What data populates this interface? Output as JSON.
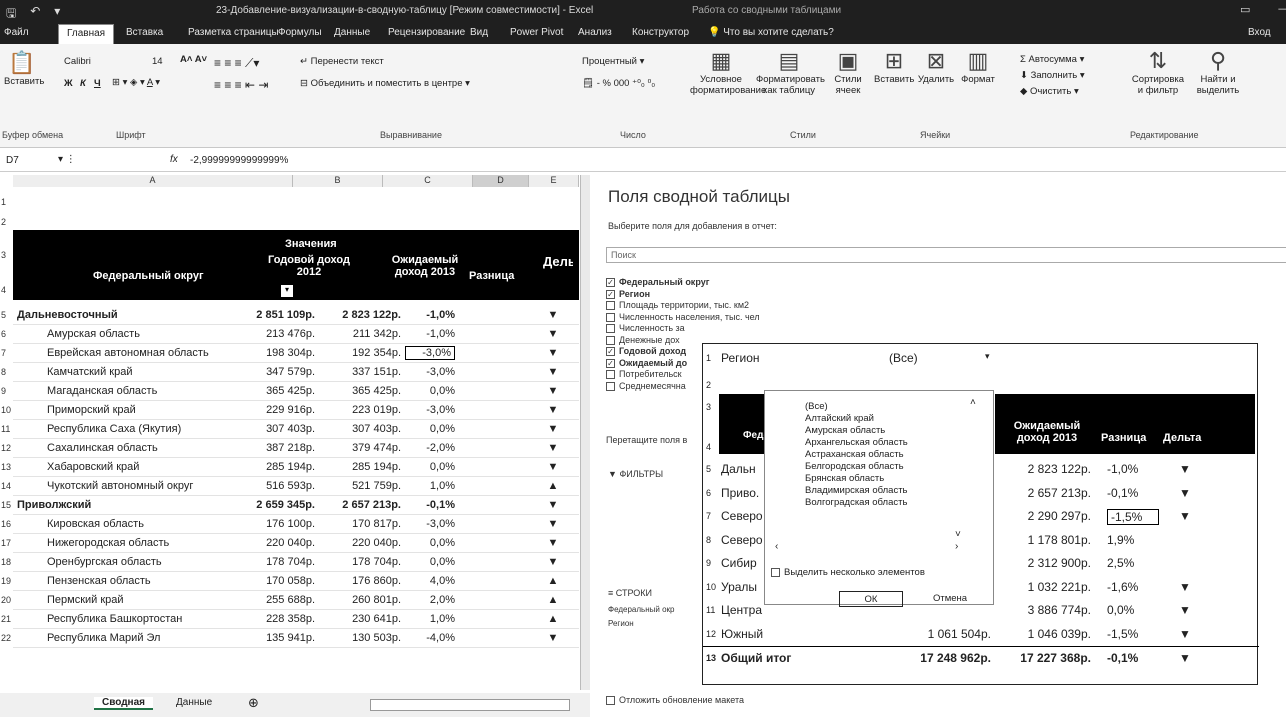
{
  "titlebar": {
    "save_icon": "save-icon",
    "undo_icon": "undo-icon",
    "title": "23-Добавление-визуализации-в-сводную-таблицу [Режим совместимости] - Excel",
    "context": "Работа со сводными таблицами",
    "restore": "▭",
    "minimize": "—"
  },
  "tabs": [
    "Файл",
    "Главная",
    "Вставка",
    "Разметка страницы",
    "Формулы",
    "Данные",
    "Рецензирование",
    "Вид",
    "Power Pivot",
    "Анализ",
    "Конструктор",
    "Что вы хотите сделать?",
    "Вход"
  ],
  "ribbon": {
    "paste": "Вставить",
    "font": "Calibri",
    "font_size": "14",
    "bold": "Ж",
    "italic": "К",
    "underline": "Ч",
    "wrap": "Перенести текст",
    "merge": "Объединить и поместить в центре",
    "number_format": "Процентный",
    "cond_format": "Условное форматирование",
    "format_table": "Форматировать как таблицу",
    "cell_styles": "Стили ячеек",
    "insert": "Вставить",
    "delete": "Удалить",
    "format": "Формат",
    "autosum": "Автосумма",
    "fill": "Заполнить",
    "clear": "Очистить",
    "sort": "Сортировка и фильтр",
    "find": "Найти и выделить",
    "groups": [
      "Буфер обмена",
      "Шрифт",
      "Выравнивание",
      "Число",
      "Стили",
      "Ячейки",
      "Редактирование"
    ]
  },
  "formula_bar": {
    "cell": "D7",
    "fx": "fx",
    "value": "-2,99999999999999%"
  },
  "columns": [
    "A",
    "B",
    "C",
    "D",
    "E"
  ],
  "header": {
    "values": "Значения",
    "district": "Федеральный округ",
    "income2012": "Годовой доход 2012",
    "income2013": "Ожидаемый доход 2013",
    "diff": "Разница",
    "delta": "Дельта"
  },
  "rows": [
    {
      "n": "5",
      "a": "Дальневосточный",
      "b": "2 851 109р.",
      "c": "2 823 122р.",
      "d": "-1,0%",
      "e": "▼",
      "bold": true
    },
    {
      "n": "6",
      "a": "Амурская область",
      "b": "213 476р.",
      "c": "211 342р.",
      "d": "-1,0%",
      "e": "▼"
    },
    {
      "n": "7",
      "a": "Еврейская автономная область",
      "b": "198 304р.",
      "c": "192 354р.",
      "d": "-3,0%",
      "e": "▼"
    },
    {
      "n": "8",
      "a": "Камчатский край",
      "b": "347 579р.",
      "c": "337 151р.",
      "d": "-3,0%",
      "e": "▼"
    },
    {
      "n": "9",
      "a": "Магаданская область",
      "b": "365 425р.",
      "c": "365 425р.",
      "d": "0,0%",
      "e": "▼"
    },
    {
      "n": "10",
      "a": "Приморский край",
      "b": "229 916р.",
      "c": "223 019р.",
      "d": "-3,0%",
      "e": "▼"
    },
    {
      "n": "11",
      "a": "Республика Саха (Якутия)",
      "b": "307 403р.",
      "c": "307 403р.",
      "d": "0,0%",
      "e": "▼"
    },
    {
      "n": "12",
      "a": "Сахалинская область",
      "b": "387 218р.",
      "c": "379 474р.",
      "d": "-2,0%",
      "e": "▼"
    },
    {
      "n": "13",
      "a": "Хабаровский край",
      "b": "285 194р.",
      "c": "285 194р.",
      "d": "0,0%",
      "e": "▼"
    },
    {
      "n": "14",
      "a": "Чукотский автономный округ",
      "b": "516 593р.",
      "c": "521 759р.",
      "d": "1,0%",
      "e": "▲"
    },
    {
      "n": "15",
      "a": "Приволжский",
      "b": "2 659 345р.",
      "c": "2 657 213р.",
      "d": "-0,1%",
      "e": "▼",
      "bold": true
    },
    {
      "n": "16",
      "a": "Кировская область",
      "b": "176 100р.",
      "c": "170 817р.",
      "d": "-3,0%",
      "e": "▼"
    },
    {
      "n": "17",
      "a": "Нижегородская область",
      "b": "220 040р.",
      "c": "220 040р.",
      "d": "0,0%",
      "e": "▼"
    },
    {
      "n": "18",
      "a": "Оренбургская область",
      "b": "178 704р.",
      "c": "178 704р.",
      "d": "0,0%",
      "e": "▼"
    },
    {
      "n": "19",
      "a": "Пензенская область",
      "b": "170 058р.",
      "c": "176 860р.",
      "d": "4,0%",
      "e": "▲"
    },
    {
      "n": "20",
      "a": "Пермский край",
      "b": "255 688р.",
      "c": "260 801р.",
      "d": "2,0%",
      "e": "▲"
    },
    {
      "n": "21",
      "a": "Республика Башкортостан",
      "b": "228 358р.",
      "c": "230 641р.",
      "d": "1,0%",
      "e": "▲"
    },
    {
      "n": "22",
      "a": "Республика Марий Эл",
      "b": "135 941р.",
      "c": "130 503р.",
      "d": "-4,0%",
      "e": "▼"
    }
  ],
  "panel": {
    "title": "Поля сводной таблицы",
    "subtitle": "Выберите поля для добавления в отчет:",
    "search": "Поиск",
    "fields": [
      {
        "label": "Федеральный округ",
        "checked": true,
        "bold": true
      },
      {
        "label": "Регион",
        "checked": true,
        "bold": true
      },
      {
        "label": "Площадь территории, тыс. км2",
        "checked": false
      },
      {
        "label": "Численность населения, тыс. чел",
        "checked": false
      },
      {
        "label": "Численность за",
        "checked": false
      },
      {
        "label": "Денежные дох",
        "checked": false
      },
      {
        "label": "Годовой доход",
        "checked": true,
        "bold": true
      },
      {
        "label": "Ожидаемый до",
        "checked": true,
        "bold": true
      },
      {
        "label": "Потребительск",
        "checked": false
      },
      {
        "label": "Среднемесячна",
        "checked": false
      }
    ],
    "drag": "Перетащите поля в",
    "filters": "ФИЛЬТРЫ",
    "rows_area": "СТРОКИ",
    "row_items": [
      "Федеральный окр",
      "Регион"
    ],
    "defer": "Отложить обновление макета"
  },
  "pivot2": {
    "filter_label": "Регион",
    "filter_value": "(Все)",
    "header_income": "Ожидаемый доход 2013",
    "header_diff": "Разница",
    "header_delta": "Дельта",
    "header_district": "Феде",
    "rows": [
      {
        "n": "5",
        "a": "Дальн",
        "c": "2 823 122р.",
        "d": "-1,0%",
        "e": "▼"
      },
      {
        "n": "6",
        "a": "Приво.",
        "c": "2 657 213р.",
        "d": "-0,1%",
        "e": "▼"
      },
      {
        "n": "7",
        "a": "Северо",
        "c": "2 290 297р.",
        "d": "-1,5%",
        "e": "▼"
      },
      {
        "n": "8",
        "a": "Северо",
        "c": "1 178 801р.",
        "d": "1,9%",
        "e": ""
      },
      {
        "n": "9",
        "a": "Сибир",
        "c": "2 312 900р.",
        "d": "2,5%",
        "e": ""
      },
      {
        "n": "10",
        "a": "Уралы",
        "c": "1 032 221р.",
        "d": "-1,6%",
        "e": "▼"
      },
      {
        "n": "11",
        "a": "Центра",
        "c": "3 886 774р.",
        "d": "0,0%",
        "e": "▼"
      },
      {
        "n": "12",
        "a": "Южный",
        "b": "1 061 504р.",
        "c": "1 046 039р.",
        "d": "-1,5%",
        "e": "▼"
      }
    ],
    "total": {
      "n": "13",
      "a": "Общий итог",
      "b": "17 248 962р.",
      "c": "17 227 368р.",
      "d": "-0,1%",
      "e": "▼"
    },
    "row_nums_top": [
      "1",
      "2",
      "3",
      "4"
    ]
  },
  "dropdown": {
    "items": [
      "(Все)",
      "Алтайский край",
      "Амурская область",
      "Архангельская область",
      "Астраханская область",
      "Белгородская область",
      "Брянская область",
      "Владимирская область",
      "Волгоградская область"
    ],
    "multi": "Выделить несколько элементов",
    "ok": "ОК",
    "cancel": "Отмена"
  },
  "sheets": {
    "active": "Сводная",
    "other": "Данные",
    "add": "⊕"
  }
}
